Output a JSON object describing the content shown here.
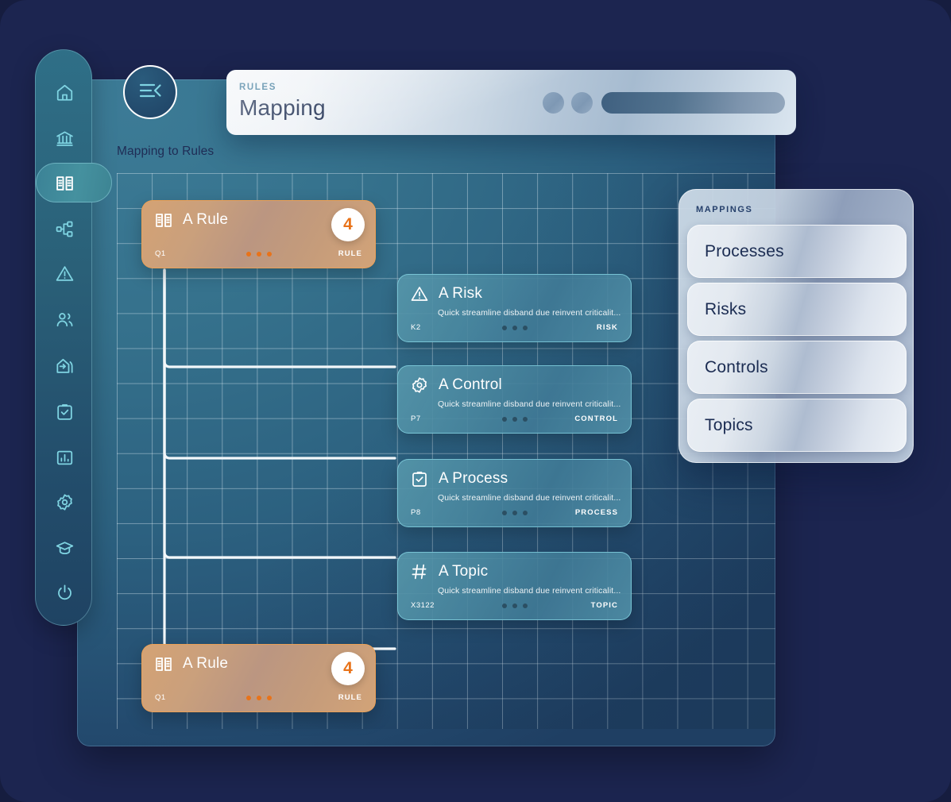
{
  "header": {
    "kicker": "RULES",
    "title": "Mapping",
    "controls": [
      "circle-1",
      "circle-2",
      "search-pill"
    ]
  },
  "panel": {
    "caption": "Mapping to Rules"
  },
  "collapse_button": {
    "icon": "collapse-menu-icon"
  },
  "sidebar": {
    "items": [
      {
        "label": "Home",
        "icon": "home-icon",
        "active": false
      },
      {
        "label": "Institution",
        "icon": "bank-icon",
        "active": false
      },
      {
        "label": "Rules",
        "icon": "book-icon",
        "active": true
      },
      {
        "label": "Hierarchy",
        "icon": "network-icon",
        "active": false
      },
      {
        "label": "Risks",
        "icon": "warning-triangle-icon",
        "active": false
      },
      {
        "label": "People",
        "icon": "users-icon",
        "active": false
      },
      {
        "label": "Import",
        "icon": "import-house-icon",
        "active": false
      },
      {
        "label": "Tasks",
        "icon": "clipboard-check-icon",
        "active": false
      },
      {
        "label": "Reports",
        "icon": "bar-chart-icon",
        "active": false
      },
      {
        "label": "Settings",
        "icon": "gear-icon",
        "active": false
      },
      {
        "label": "Learning",
        "icon": "graduation-cap-icon",
        "active": false
      },
      {
        "label": "Logout",
        "icon": "power-icon",
        "active": false
      }
    ]
  },
  "nodes": [
    {
      "kind": "rule",
      "icon": "book-icon",
      "title": "A Rule",
      "description": "",
      "code": "Q1",
      "type": "RULE",
      "badge": "4"
    },
    {
      "kind": "item",
      "icon": "warning-triangle-icon",
      "title": "A Risk",
      "description": "Quick streamline disband due reinvent criticalit...",
      "code": "K2",
      "type": "RISK",
      "badge": ""
    },
    {
      "kind": "item",
      "icon": "gear-icon",
      "title": "A Control",
      "description": "Quick streamline disband due reinvent criticalit...",
      "code": "P7",
      "type": "CONTROL",
      "badge": ""
    },
    {
      "kind": "item",
      "icon": "clipboard-check-icon",
      "title": "A Process",
      "description": "Quick streamline disband due reinvent criticalit...",
      "code": "P8",
      "type": "PROCESS",
      "badge": ""
    },
    {
      "kind": "item",
      "icon": "hash-icon",
      "title": "A Topic",
      "description": "Quick streamline disband due reinvent criticalit...",
      "code": "X3122",
      "type": "TOPIC",
      "badge": ""
    },
    {
      "kind": "rule",
      "icon": "book-icon",
      "title": "A Rule",
      "description": "",
      "code": "Q1",
      "type": "RULE",
      "badge": "4"
    }
  ],
  "mappings": {
    "title": "MAPPINGS",
    "items": [
      "Processes",
      "Risks",
      "Controls",
      "Topics"
    ]
  },
  "colors": {
    "page_background": "#1c2550",
    "panel_teal": "#35718c",
    "accent_orange": "#e8731a",
    "icon_cyan": "#7fd4e2",
    "rule_card": "#c89b78",
    "header_light": "#e8eef4"
  }
}
